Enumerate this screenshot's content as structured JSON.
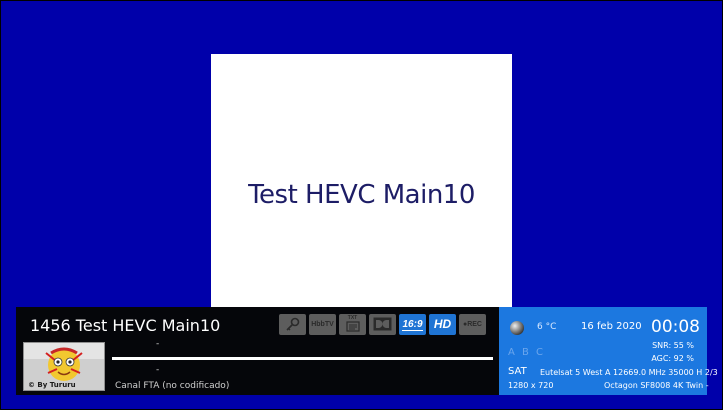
{
  "colors": {
    "background": "#0000aa",
    "test_card": "#ffffff",
    "test_card_text": "#1d1d66",
    "infobar_dark": "#05060a",
    "infobar_accent": "#1c78e0",
    "badge_inactive": "#5d5d5d",
    "badge_active": "#1f74d4"
  },
  "video": {
    "test_card_title": "Test HEVC Main10"
  },
  "infobar": {
    "channel_title": "1456 Test HEVC Main10",
    "badges": [
      {
        "name": "cryptokey-badge",
        "icon": "key-icon",
        "active": false
      },
      {
        "name": "hbbtv-badge",
        "label": "HbbTV",
        "active": false
      },
      {
        "name": "teletext-badge",
        "label": "TXT",
        "icon": "teletext-icon",
        "active": false
      },
      {
        "name": "dolby-badge",
        "icon": "dolby-icon",
        "active": false
      },
      {
        "name": "aspect-ratio-badge",
        "label": "16:9",
        "active": true
      },
      {
        "name": "hd-badge",
        "label": "HD",
        "active": true
      },
      {
        "name": "rec-badge",
        "label": "●REC",
        "active": false
      }
    ],
    "picon": {
      "icon": "mascot-picon",
      "text": "© By Tururu"
    },
    "now_event": "-",
    "next_event": "-",
    "event_progress": 1.0,
    "encryption_status": "Canal FTA (no codificado)"
  },
  "status_panel": {
    "weather_icon": "moon-icon",
    "temperature": "6 °C",
    "date": "16 feb 2020",
    "time": "00:08",
    "abc_indicator": "A B C",
    "snr": "SNR:  55 %",
    "agc": "AGC:  92 %",
    "tuner_type": "SAT",
    "transponder": "Eutelsat 5 West A 12669.0 MHz 35000 H 2/3",
    "resolution": "1280 x 720",
    "receiver_model": "Octagon SF8008 4K Twin -"
  }
}
